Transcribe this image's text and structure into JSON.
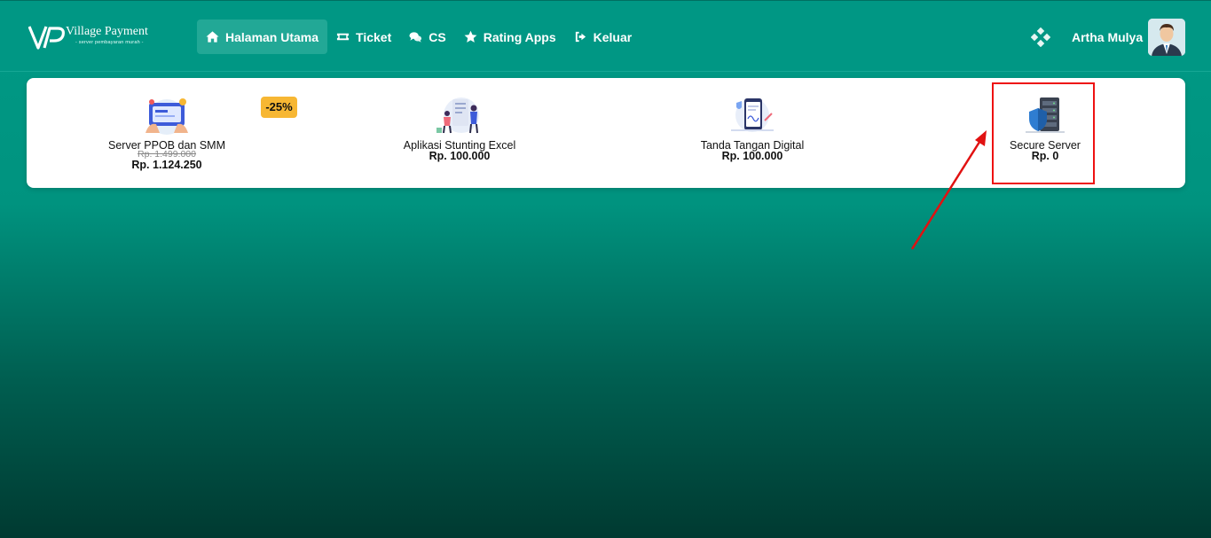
{
  "brand": {
    "title": "Village Payment",
    "tagline": "- server pembayaran murah -"
  },
  "nav": {
    "items": [
      {
        "label": "Halaman Utama",
        "icon": "home-icon",
        "active": true
      },
      {
        "label": "Ticket",
        "icon": "ticket-icon",
        "active": false
      },
      {
        "label": "CS",
        "icon": "chat-icon",
        "active": false
      },
      {
        "label": "Rating Apps",
        "icon": "star-icon",
        "active": false
      },
      {
        "label": "Keluar",
        "icon": "sign-out-icon",
        "active": false
      }
    ]
  },
  "user": {
    "name": "Artha Mulya"
  },
  "products": [
    {
      "name": "Server PPOB dan SMM",
      "old_price": "Rp. 1.499.000",
      "price": "Rp. 1.124.250",
      "discount": "-25%"
    },
    {
      "name": "Aplikasi Stunting Excel",
      "price": "Rp. 100.000"
    },
    {
      "name": "Tanda Tangan Digital",
      "price": "Rp. 100.000"
    },
    {
      "name": "Secure Server",
      "price": "Rp. 0"
    }
  ],
  "colors": {
    "topbar": "#009784",
    "nav_active": "#22a896",
    "badge": "#f7b733",
    "annotation": "#e11111"
  }
}
